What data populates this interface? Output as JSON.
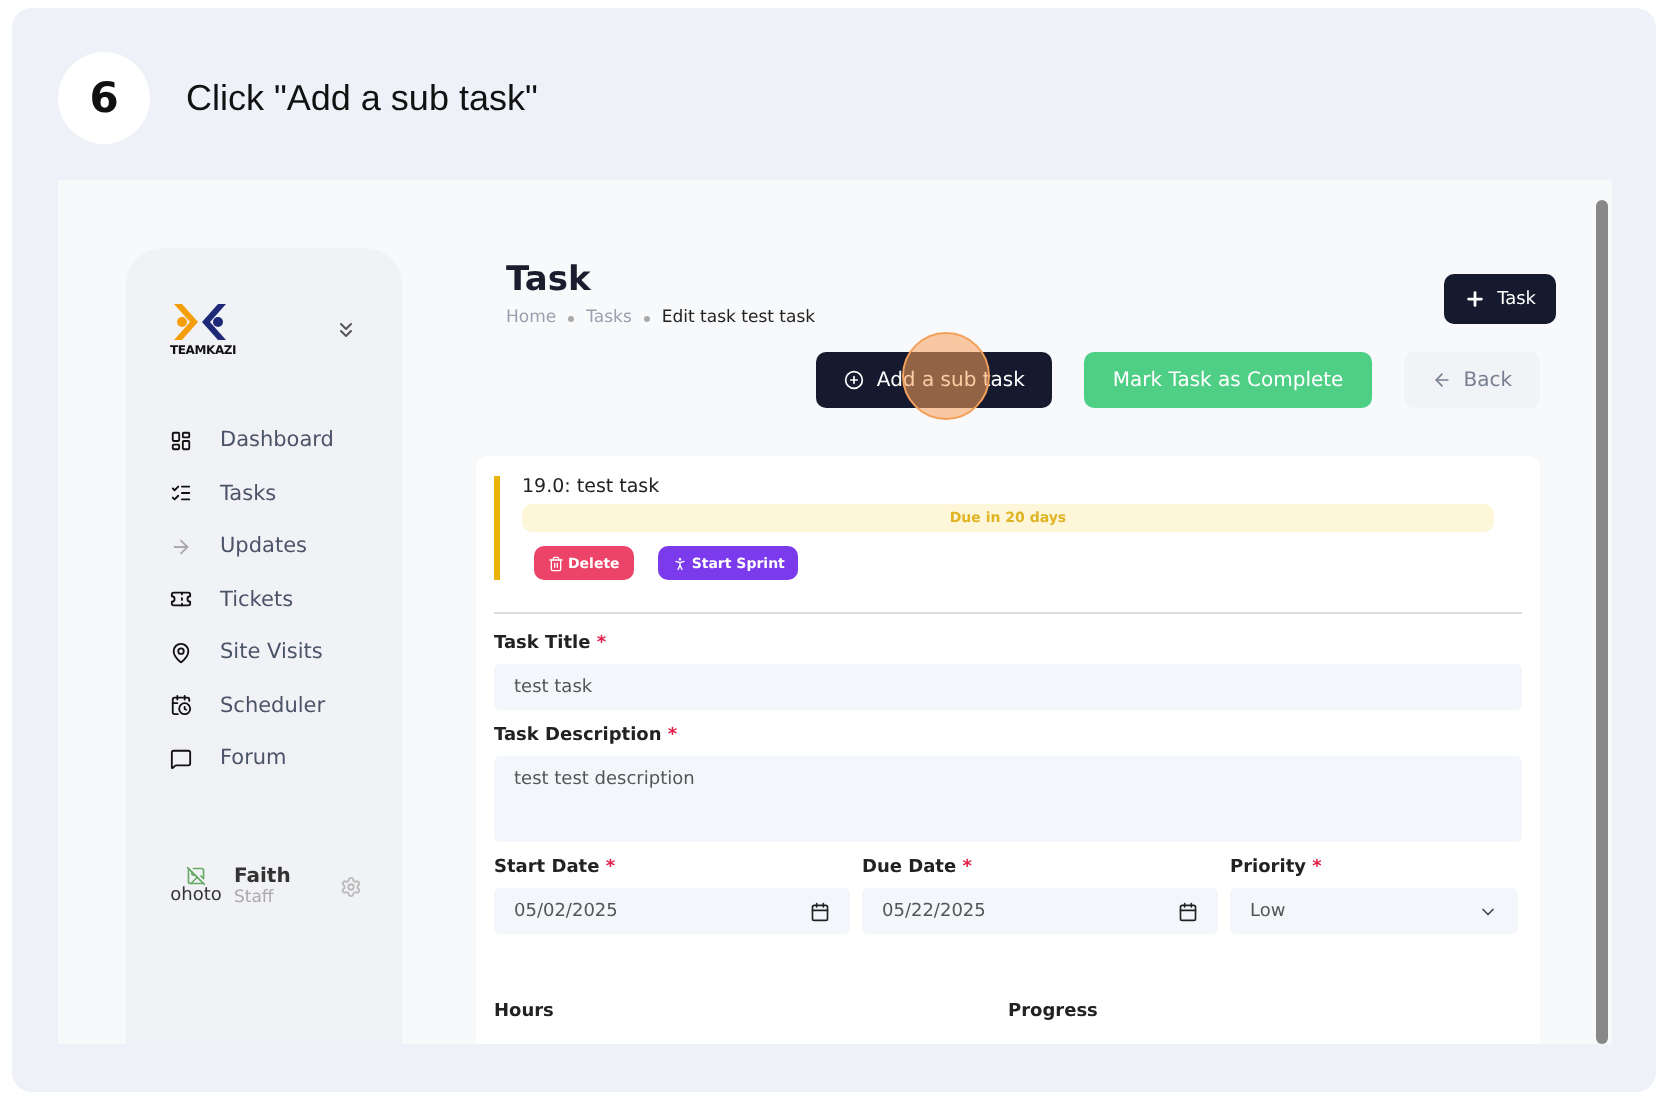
{
  "step": {
    "number": "6",
    "instruction": "Click \"Add a sub task\""
  },
  "sidebar": {
    "logo_text": "TEAMKAZI",
    "items": [
      {
        "label": "Dashboard",
        "selected": false
      },
      {
        "label": "Tasks",
        "selected": false
      },
      {
        "label": "Updates",
        "selected": false
      },
      {
        "label": "Tickets",
        "selected": false
      },
      {
        "label": "Site Visits",
        "selected": false
      },
      {
        "label": "Scheduler",
        "selected": false
      },
      {
        "label": "Forum",
        "selected": false
      }
    ],
    "user": {
      "avatar_alt": "ohoto",
      "name": "Faith",
      "role": "Staff"
    }
  },
  "header": {
    "title": "Task",
    "breadcrumbs": [
      "Home",
      "Tasks",
      "Edit task test task"
    ],
    "new_button": "Task"
  },
  "actions": {
    "add_subtask": "Add a sub task",
    "complete": "Mark Task as Complete",
    "back": "Back"
  },
  "task_card": {
    "heading": "19.0: test task",
    "due": "Due in 20 days",
    "delete": "Delete",
    "sprint": "Start Sprint"
  },
  "form": {
    "title": {
      "label": "Task Title",
      "required_mark": "*",
      "value": "test task"
    },
    "description": {
      "label": "Task Description",
      "required_mark": "*",
      "value": "test test description"
    },
    "start": {
      "label": "Start Date",
      "required_mark": "*",
      "value": "05/02/2025"
    },
    "due": {
      "label": "Due Date",
      "required_mark": "*",
      "value": "05/22/2025"
    },
    "priority": {
      "label": "Priority",
      "required_mark": "*",
      "value": "Low"
    },
    "hours": {
      "label": "Hours"
    },
    "progress": {
      "label": "Progress"
    }
  }
}
